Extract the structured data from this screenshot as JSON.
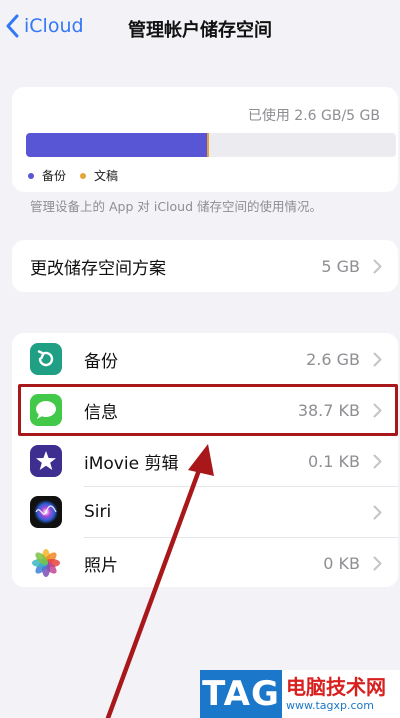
{
  "nav": {
    "back_label": "iCloud",
    "title": "管理帐户储存空间"
  },
  "storage": {
    "used_text": "已使用 2.6 GB/5 GB",
    "legend": [
      {
        "label": "备份",
        "color": "#5956d6"
      },
      {
        "label": "文稿",
        "color": "#e8a23a"
      }
    ],
    "usage_fraction": {
      "backup": 0.49,
      "documents": 0.005
    },
    "footnote": "管理设备上的 App 对 iCloud 储存空间的使用情况。"
  },
  "plan": {
    "label": "更改储存空间方案",
    "value": "5 GB"
  },
  "apps": [
    {
      "name": "备份",
      "size": "2.6 GB",
      "icon": "backup-icon"
    },
    {
      "name": "信息",
      "size": "38.7 KB",
      "icon": "messages-icon"
    },
    {
      "name": "iMovie 剪辑",
      "size": "0.1 KB",
      "icon": "imovie-icon"
    },
    {
      "name": "Siri",
      "size": "",
      "icon": "siri-icon"
    },
    {
      "name": "照片",
      "size": "0 KB",
      "icon": "photos-icon"
    }
  ],
  "watermark": {
    "tag": "TAG",
    "site_name": "电脑技术网",
    "url": "www.tagxp.com"
  },
  "colors": {
    "accent": "#3478f6",
    "highlight": "#a8181a"
  }
}
